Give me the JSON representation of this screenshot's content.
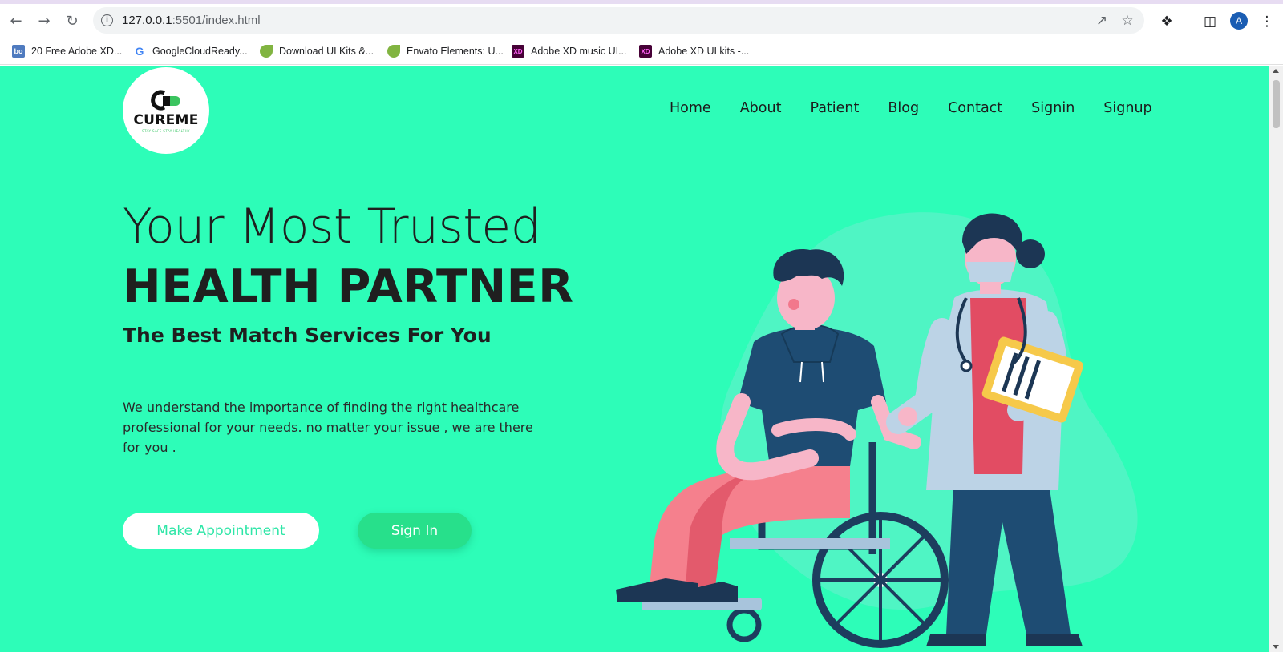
{
  "browser": {
    "url_host": "127.0.0.1",
    "url_path": ":5501/index.html",
    "profile_initial": "A"
  },
  "bookmarks": [
    {
      "label": "20 Free Adobe XD...",
      "icon": "bo"
    },
    {
      "label": "GoogleCloudReady...",
      "icon": "G"
    },
    {
      "label": "Download UI Kits &...",
      "icon": "leaf"
    },
    {
      "label": "Envato Elements: U...",
      "icon": "leaf"
    },
    {
      "label": "Adobe XD music UI...",
      "icon": "XD"
    },
    {
      "label": "Adobe XD UI kits -...",
      "icon": "XD"
    }
  ],
  "site": {
    "logo_text": "CUREME",
    "logo_tagline": "STAY SAFE STAY HEALTHY",
    "nav": [
      "Home",
      "About",
      "Patient",
      "Blog",
      "Contact",
      "Signin",
      "Signup"
    ],
    "hero": {
      "title_line1": "Your Most Trusted",
      "title_line2": "HEALTH PARTNER",
      "subtitle": "The Best Match Services For You",
      "description": "We understand the importance of finding the right healthcare professional for your needs. no matter your issue , we are there for you ."
    },
    "buttons": {
      "appointment": "Make Appointment",
      "signin": "Sign In"
    }
  },
  "colors": {
    "page_bg": "#2dfdb8",
    "accent_green": "#27e08b"
  }
}
